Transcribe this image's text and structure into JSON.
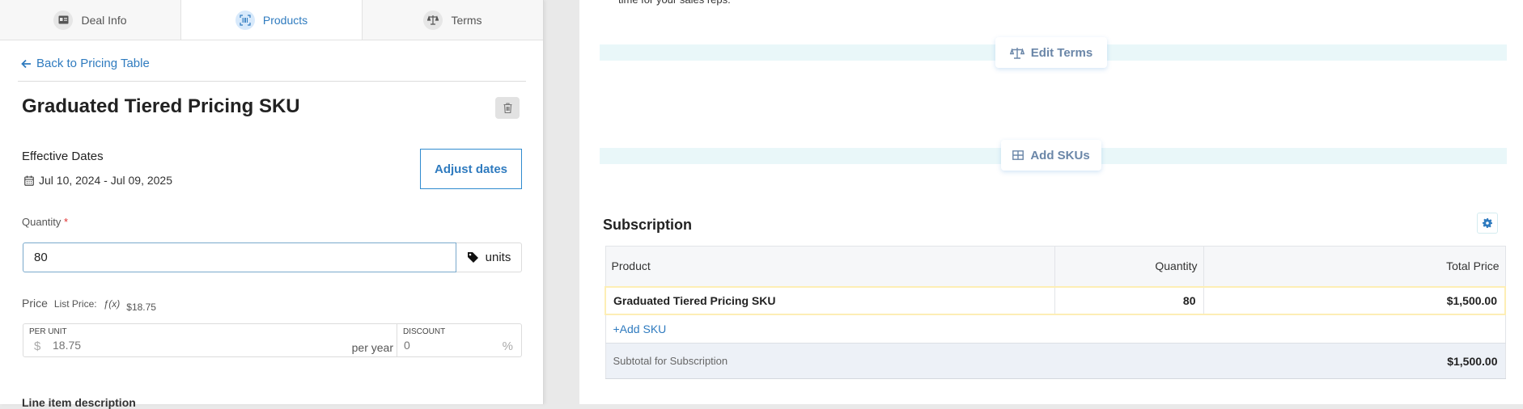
{
  "tabs": [
    {
      "label": "Deal Info",
      "icon": "id-card-icon",
      "active": false
    },
    {
      "label": "Products",
      "icon": "barcode-scan-icon",
      "active": true
    },
    {
      "label": "Terms",
      "icon": "scale-icon",
      "active": false
    }
  ],
  "editor": {
    "back_link": "Back to Pricing Table",
    "title": "Graduated Tiered Pricing SKU",
    "effective_dates_label": "Effective Dates",
    "effective_dates_value": "Jul 10, 2024 - Jul 09, 2025",
    "adjust_dates_label": "Adjust dates",
    "quantity_label": "Quantity",
    "quantity_required_mark": "*",
    "quantity_value": "80",
    "units_label": "units",
    "price_label": "Price",
    "list_price_label": "List Price:",
    "fx_symbol": "ƒ(x)",
    "list_price_value": "$18.75",
    "per_unit_label": "PER UNIT",
    "currency_symbol": "$",
    "per_unit_placeholder": "18.75",
    "per_period": "per year",
    "discount_label": "DISCOUNT",
    "discount_placeholder": "0",
    "percent_symbol": "%",
    "line_item_description_label": "Line item description"
  },
  "preview": {
    "top_text": "time for your sales reps.",
    "edit_terms_label": "Edit Terms",
    "add_skus_label": "Add SKUs",
    "section_title": "Subscription",
    "table": {
      "headers": [
        "Product",
        "Quantity",
        "Total Price"
      ],
      "rows": [
        {
          "product": "Graduated Tiered Pricing SKU",
          "quantity": "80",
          "total_price": "$1,500.00"
        }
      ],
      "add_sku_label": "+Add SKU",
      "subtotal_label": "Subtotal for Subscription",
      "subtotal_value": "$1,500.00"
    }
  },
  "colors": {
    "accent": "#2f7bbf",
    "selected_row_border": "#fdeeb5",
    "band": "#e9f7f9",
    "subtotal_bg": "#edf1f7"
  }
}
